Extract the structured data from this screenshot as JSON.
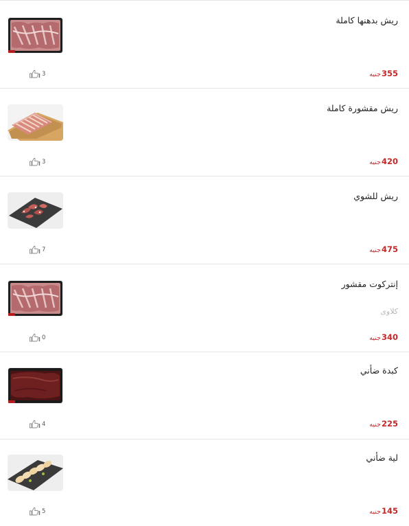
{
  "colors": {
    "price": "#c62828",
    "divider": "#e6e6e6",
    "subtitle": "#b8b8b8"
  },
  "items": [
    {
      "title": "ريش بدهنها كاملة",
      "subtitle": "",
      "price": "355",
      "currency": "جنيه",
      "likes": "3",
      "image": "lamb-ribs-tray"
    },
    {
      "title": "ريش مقشورة كاملة",
      "subtitle": "",
      "price": "420",
      "currency": "جنيه",
      "likes": "3",
      "image": "lamb-rack-board"
    },
    {
      "title": "ريش للشوي",
      "subtitle": "",
      "price": "475",
      "currency": "جنيه",
      "likes": "7",
      "image": "grill-chops-slate"
    },
    {
      "title": "إنتركوت مقشور",
      "subtitle": "كلاوى",
      "price": "340",
      "currency": "جنيه",
      "likes": "0",
      "image": "lamb-ribs-tray"
    },
    {
      "title": "كبدة ضأني",
      "subtitle": "",
      "price": "225",
      "currency": "جنيه",
      "likes": "4",
      "image": "liver-tray"
    },
    {
      "title": "لية ضأني",
      "subtitle": "",
      "price": "145",
      "currency": "جنيه",
      "likes": "5",
      "image": "fat-slate"
    }
  ]
}
